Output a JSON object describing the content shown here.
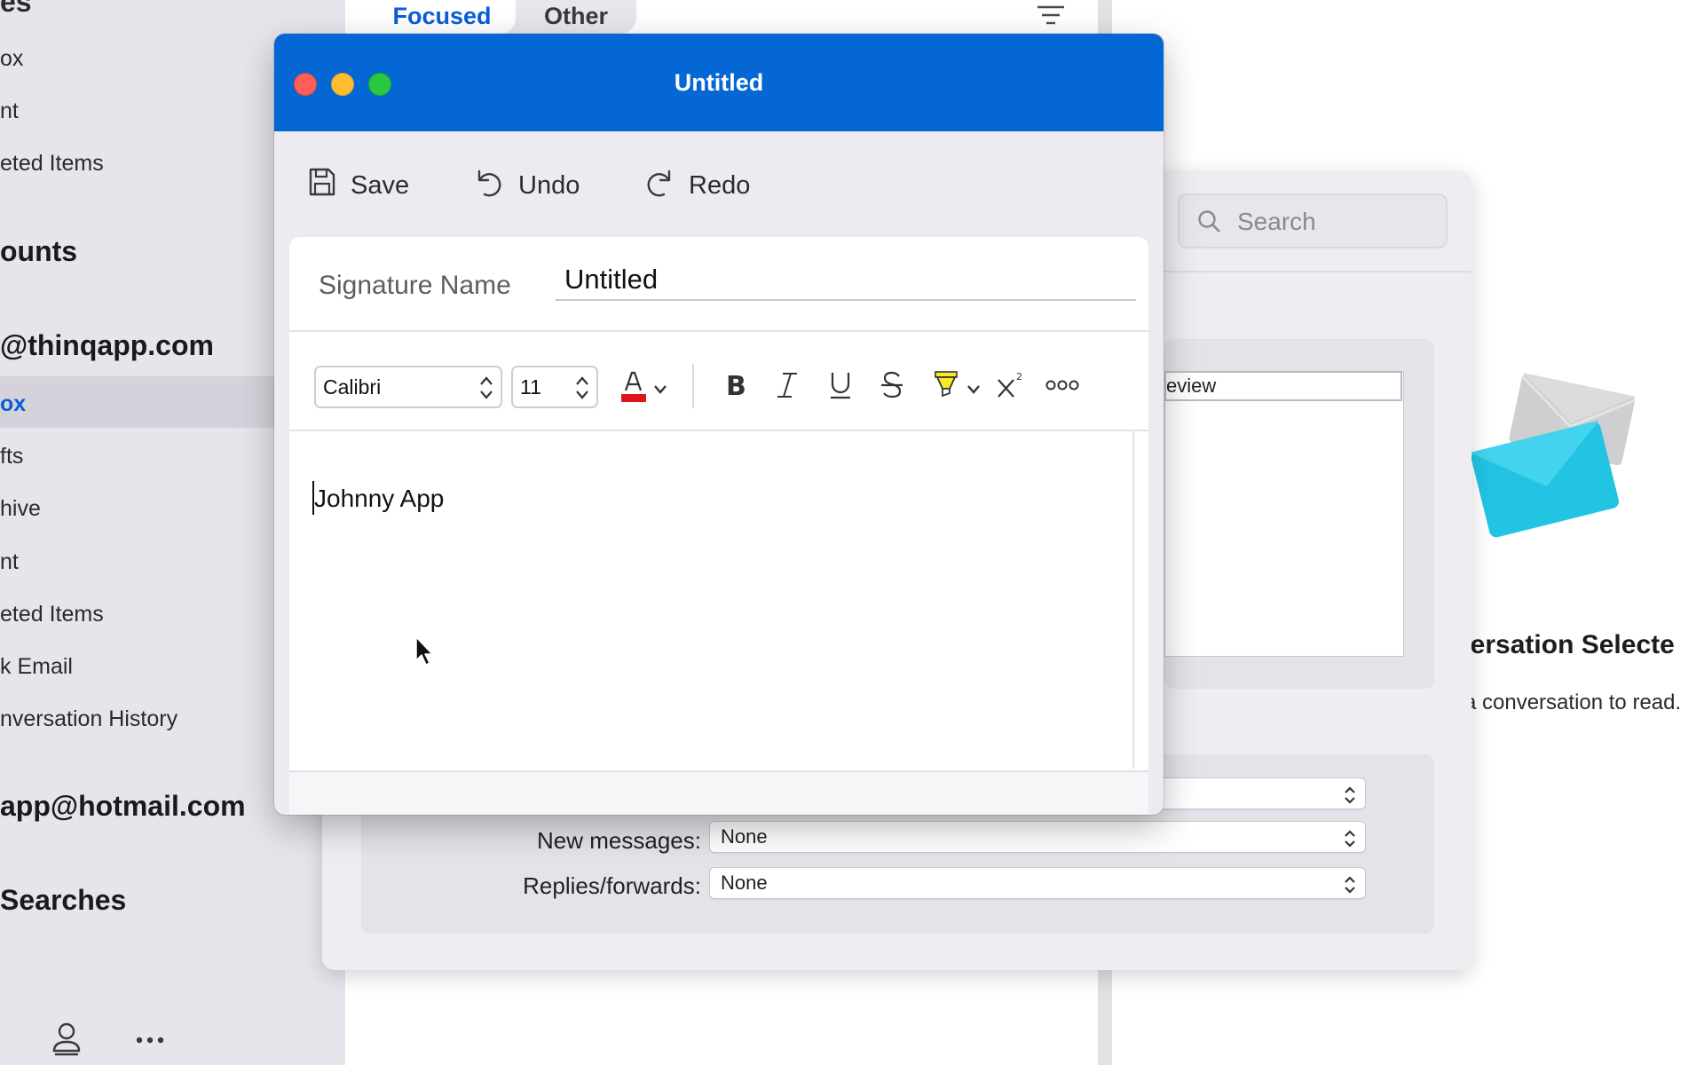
{
  "sidebar": {
    "items_top": [
      {
        "label": "es"
      },
      {
        "label": "ox"
      },
      {
        "label": "nt"
      },
      {
        "label": "eted Items"
      }
    ],
    "section_accounts": "ounts",
    "account1": "@thinqapp.com",
    "account1_items": [
      {
        "label": "ox",
        "active": true
      },
      {
        "label": "fts"
      },
      {
        "label": "hive"
      },
      {
        "label": "nt"
      },
      {
        "label": "eted Items"
      },
      {
        "label": "k Email"
      },
      {
        "label": "nversation History"
      }
    ],
    "account2": "app@hotmail.com",
    "section_searches": "Searches"
  },
  "mail_list": {
    "tabs": [
      {
        "label": "Focused",
        "selected": true
      },
      {
        "label": "Other",
        "selected": false
      }
    ]
  },
  "preferences": {
    "search_placeholder": "Search",
    "list_header": "eview",
    "rows": [
      {
        "label": "",
        "value": ""
      },
      {
        "label": "New messages:",
        "value": "None"
      },
      {
        "label": "Replies/forwards:",
        "value": "None"
      }
    ]
  },
  "reading_pane": {
    "title": "versation Selecte",
    "subtitle": "a conversation to read."
  },
  "signature_window": {
    "title": "Untitled",
    "toolbar": {
      "save": "Save",
      "undo": "Undo",
      "redo": "Redo"
    },
    "name_label": "Signature Name",
    "name_value": "Untitled",
    "font_family": "Calibri",
    "font_size": "11",
    "font_color": "#e0141e",
    "highlight_color": "#f7e928",
    "body_text": "Johnny App"
  },
  "colors": {
    "accent": "#0467d4",
    "focused_tab_text": "#0a5ed7"
  }
}
